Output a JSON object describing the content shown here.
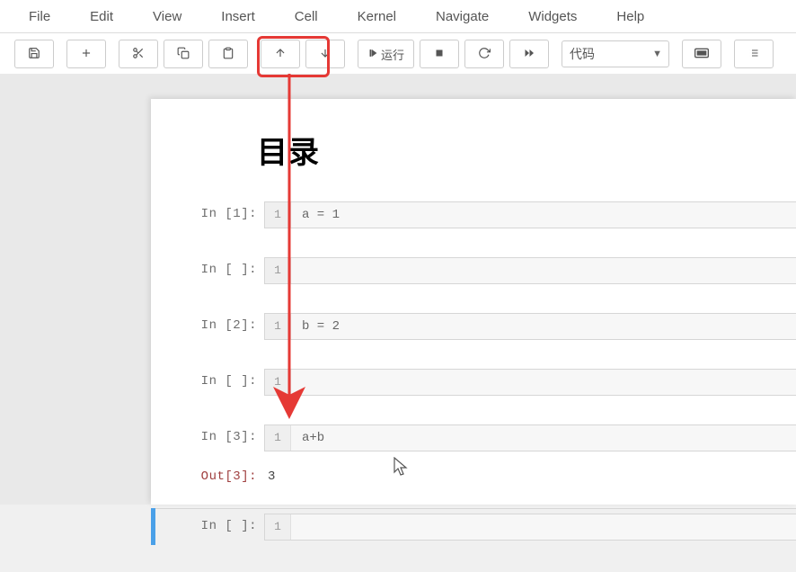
{
  "menu": {
    "items": [
      "File",
      "Edit",
      "View",
      "Insert",
      "Cell",
      "Kernel",
      "Navigate",
      "Widgets",
      "Help"
    ]
  },
  "toolbar": {
    "run_label": "运行",
    "cell_type_selected": "代码"
  },
  "notebook": {
    "title": "目录",
    "gutter_line": "1",
    "cells": [
      {
        "kind": "in",
        "exec": "1",
        "code": "a = 1"
      },
      {
        "kind": "in",
        "exec": " ",
        "code": ""
      },
      {
        "kind": "in",
        "exec": "2",
        "code": "b = 2"
      },
      {
        "kind": "in",
        "exec": " ",
        "code": ""
      },
      {
        "kind": "in",
        "exec": "3",
        "code": "a+b"
      },
      {
        "kind": "out",
        "exec": "3",
        "text": "3"
      },
      {
        "kind": "in",
        "exec": " ",
        "code": "",
        "selected": true
      }
    ]
  },
  "annotation": {
    "highlight_color": "#e53935"
  }
}
